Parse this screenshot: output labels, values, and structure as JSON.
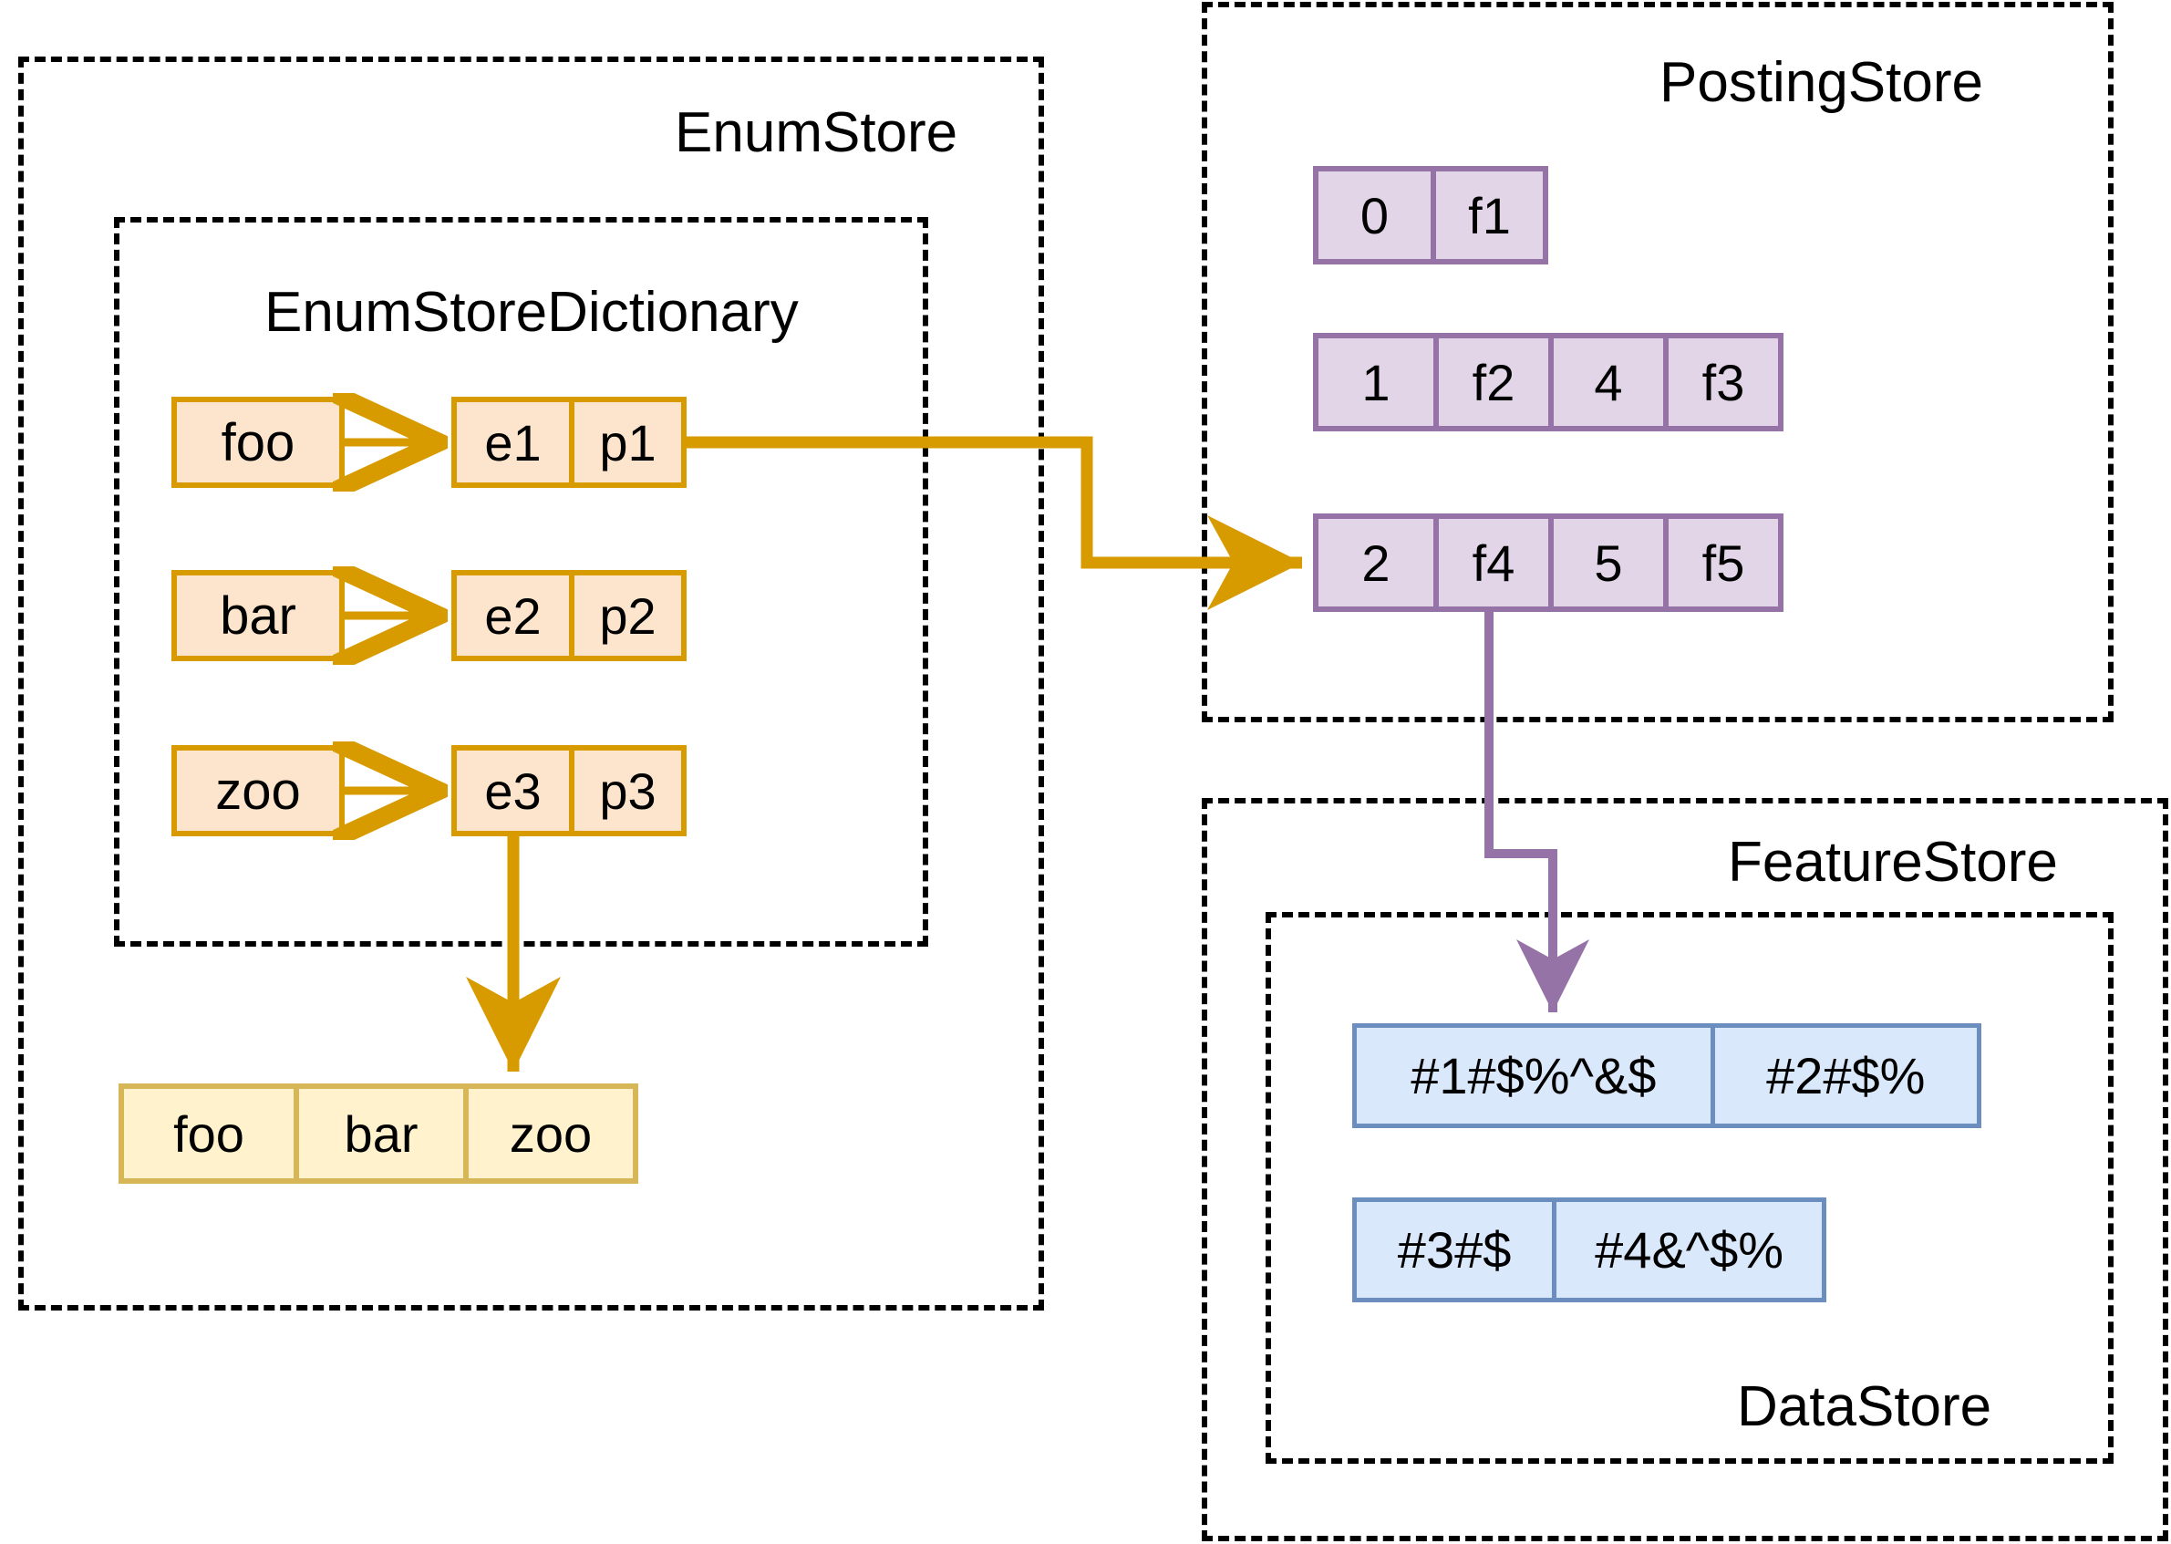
{
  "diagram": {
    "title": "Vespa attribute store layout diagram",
    "colors": {
      "orange_fill": "#fde5cd",
      "orange_stroke": "#d79b00",
      "yellow_fill": "#fff2cc",
      "yellow_stroke": "#d6b656",
      "purple_fill": "#e1d5e7",
      "purple_stroke": "#9673a6",
      "blue_fill": "#dae8fc",
      "blue_stroke": "#6c8ebf",
      "container_stroke": "#000000"
    }
  },
  "containers": {
    "enum_store": {
      "label": "EnumStore"
    },
    "enum_store_dictionary": {
      "label": "EnumStoreDictionary"
    },
    "posting_store": {
      "label": "PostingStore"
    },
    "feature_store": {
      "label": "FeatureStore"
    },
    "data_store": {
      "label": "DataStore"
    }
  },
  "enum_store": {
    "keys": [
      {
        "label": "foo"
      },
      {
        "label": "bar"
      },
      {
        "label": "zoo"
      }
    ],
    "entries": [
      {
        "enum": "e1",
        "posting": "p1"
      },
      {
        "enum": "e2",
        "posting": "p2"
      },
      {
        "enum": "e3",
        "posting": "p3"
      }
    ],
    "values_row": [
      "foo",
      "bar",
      "zoo"
    ]
  },
  "posting_store": {
    "rows": [
      {
        "cells": [
          "0",
          "f1"
        ]
      },
      {
        "cells": [
          "1",
          "f2",
          "4",
          "f3"
        ]
      },
      {
        "cells": [
          "2",
          "f4",
          "5",
          "f5"
        ]
      }
    ]
  },
  "data_store": {
    "rows": [
      {
        "cells": [
          "#1#$%^&$",
          "#2#$%"
        ]
      },
      {
        "cells": [
          "#3#$",
          "#4&^$%"
        ]
      }
    ]
  },
  "connectors": [
    {
      "name": "foo-to-e1",
      "color": "#d79b00"
    },
    {
      "name": "bar-to-e2",
      "color": "#d79b00"
    },
    {
      "name": "zoo-to-e3",
      "color": "#d79b00"
    },
    {
      "name": "e3-to-values",
      "color": "#d79b00"
    },
    {
      "name": "p1-to-posting-row3",
      "color": "#d79b00"
    },
    {
      "name": "posting-row3-to-feature-row1",
      "color": "#9673a6"
    }
  ]
}
